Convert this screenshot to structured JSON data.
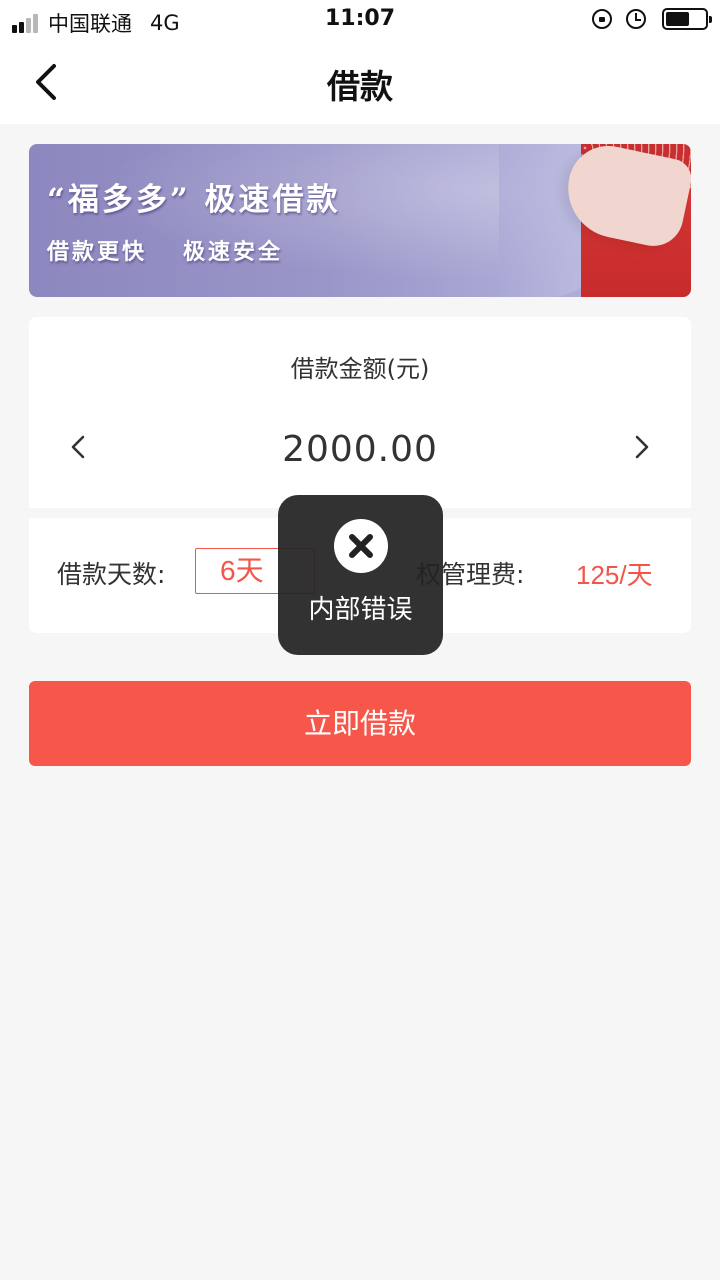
{
  "status_bar": {
    "carrier": "中国联通",
    "network": "4G",
    "time": "11:07",
    "battery_level": 0.6
  },
  "nav": {
    "title": "借款"
  },
  "banner": {
    "title": "“福多多” 极速借款",
    "sub_1": "借款更快",
    "sub_2": "极速安全"
  },
  "amount": {
    "label": "借款金额(元)",
    "value": "2000.00"
  },
  "days": {
    "label": "借款天数:",
    "value": "6天",
    "fee_label": "权管理费:",
    "fee_value": "125/天"
  },
  "submit": {
    "label": "立即借款"
  },
  "toast": {
    "message": "内部错误"
  },
  "colors": {
    "accent": "#f7574a",
    "background": "#f6f6f7"
  }
}
